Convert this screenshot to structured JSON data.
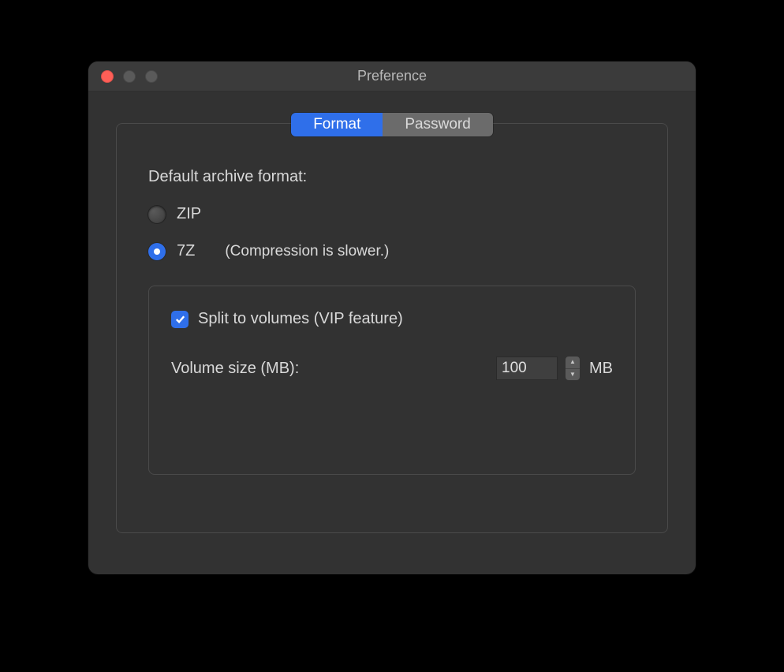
{
  "window": {
    "title": "Preference"
  },
  "tabs": [
    {
      "label": "Format",
      "active": true
    },
    {
      "label": "Password",
      "active": false
    }
  ],
  "format": {
    "default_label": "Default archive format:",
    "options": {
      "zip": {
        "label": "ZIP",
        "selected": false
      },
      "sevenz": {
        "label": "7Z",
        "selected": true,
        "hint": "(Compression is slower.)"
      }
    },
    "split": {
      "checkbox_label": "Split to volumes (VIP feature)",
      "checked": true,
      "size_label": "Volume size (MB):",
      "size_value": "100",
      "unit": "MB"
    }
  }
}
